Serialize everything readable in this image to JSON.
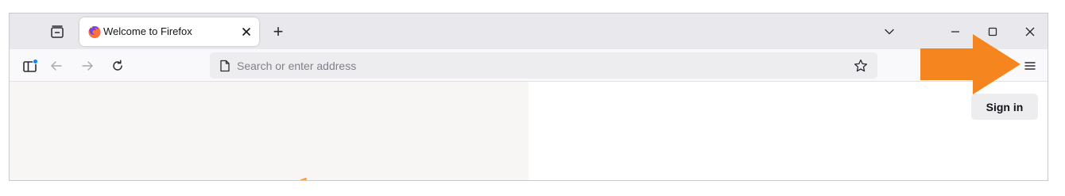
{
  "tab": {
    "title": "Welcome to Firefox",
    "favicon": "firefox-logo-icon"
  },
  "tabstrip": {
    "tabs_list_icon": "tab-list-icon",
    "new_tab_label": "+",
    "list_all_tabs_icon": "chevron-down-icon"
  },
  "window_controls": {
    "minimize_icon": "minimize-icon",
    "maximize_icon": "maximize-icon",
    "close_icon": "close-icon"
  },
  "navbar": {
    "sidebar_icon": "sidebar-icon",
    "back_icon": "arrow-left-icon",
    "forward_icon": "arrow-right-icon",
    "reload_icon": "reload-icon",
    "url_placeholder": "Search or enter address",
    "url_value": "",
    "bookmark_icon": "star-icon",
    "menu_icon": "hamburger-menu-icon"
  },
  "account": {
    "sign_in_label": "Sign in"
  },
  "annotation": {
    "arrow_color": "#f5861f",
    "points_to": "hamburger-menu-icon"
  },
  "colors": {
    "tabstrip_bg": "#e8e8ed",
    "navbar_bg": "#f9f9fb",
    "urlbar_bg": "#ededf0",
    "content_left_bg": "#f7f6f4",
    "sidebar_dot": "#0a84ff"
  }
}
